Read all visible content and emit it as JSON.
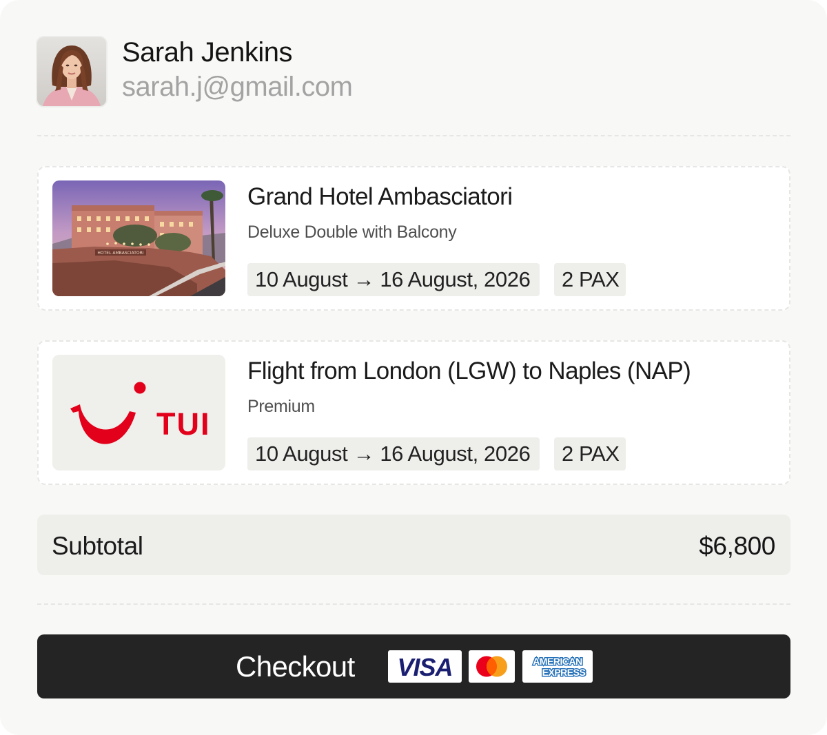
{
  "user": {
    "name": "Sarah Jenkins",
    "email": "sarah.j@gmail.com"
  },
  "bookings": [
    {
      "title": "Grand Hotel Ambasciatori",
      "subtitle": "Deluxe Double with Balcony",
      "dates": "10 August → 16 August, 2026",
      "pax": "2 PAX",
      "image": "hotel-photo",
      "sign_text": "HOTEL AMBASCIATORI"
    },
    {
      "title": "Flight from London (LGW) to Naples (NAP)",
      "subtitle": "Premium",
      "dates": "10 August → 16 August, 2026",
      "pax": "2 PAX",
      "image": "tui-logo",
      "logo_text": "TUI"
    }
  ],
  "subtotal": {
    "label": "Subtotal",
    "value": "$6,800"
  },
  "checkout": {
    "label": "Checkout",
    "payment_methods": [
      "VISA",
      "Mastercard",
      "AMERICAN EXPRESS"
    ]
  },
  "colors": {
    "background": "#f8f8f6",
    "checkout_bg": "#242424",
    "chip_bg": "#eeeeeb",
    "tui_red": "#e2001a",
    "visa_blue": "#1a1f71",
    "amex_blue": "#2671b9"
  }
}
